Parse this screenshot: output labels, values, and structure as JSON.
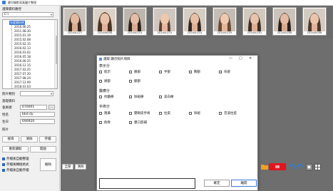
{
  "window": {
    "title": "慶印攝影寫真圖片整理"
  },
  "left": {
    "path_label": "選擇資料路徑",
    "drive": "C:\\",
    "tree_root": "年度資料夾",
    "tree_items": [
      "2010.06.25",
      "2011.08.30",
      "2015.01.19",
      "2015.02.08",
      "2015.02.15",
      "2016.02.13",
      "2016.03.02",
      "2016.05.18",
      "2016.06.25",
      "2016.12.15",
      "2017.02.25",
      "2017.07.20",
      "2017.08.24",
      "2017.12.09",
      "2018.03.03"
    ],
    "folder_label": "照片類別",
    "reg_label": "基礎資料",
    "reg_no_label": "會員號",
    "reg_no": "670001",
    "reg_btn": "...",
    "name_label": "姓名",
    "name_value": "bbd.dy",
    "birth_label": "生日",
    "birth_value": "690920",
    "photo_label": "照片",
    "btn_search": "搜尋",
    "btn_clear": "清除",
    "btn_save": "存檔",
    "btn_reload": "重新讀取",
    "btn_open": "開啟",
    "check1": "存檔後自動整理",
    "check2": "存檔後轉換格式",
    "check3": "存檔後自動存檔",
    "btn_delete": "刪除"
  },
  "thumbnails": [
    {
      "caption": "2024/01/27"
    },
    {
      "caption": "2024/06/08"
    },
    {
      "caption": "2024/02/14"
    },
    {
      "caption": "2024/01/15"
    },
    {
      "caption": "2024/01/14"
    },
    {
      "caption": "2024/01/29"
    },
    {
      "caption": "2024/01/01"
    },
    {
      "caption": "2024/03/08"
    },
    {
      "caption": "2024/05/06"
    }
  ],
  "toolbar": {
    "btn_all": "全部",
    "btn_clear": "清除"
  },
  "dialog": {
    "title": "選取 顯示照片項目",
    "ctl_min": "—",
    "ctl_max": "□",
    "ctl_close": "✕",
    "section1": "表示分",
    "section1_items": [
      "肌示",
      "臉部",
      "手部",
      "胸部",
      "背部",
      "頭部",
      "腳部"
    ],
    "section2": "醫療分",
    "section2_items": [
      "抗皺療",
      "除斑療",
      "美白療"
    ],
    "section3": "手術分",
    "section3_items": [
      "隆鼻",
      "雙眼皮手術",
      "拉皮",
      "除斑",
      "音波拉提",
      "削骨",
      "豐口唇補"
    ],
    "ok": "確定",
    "cancel": "離開"
  },
  "colors": {
    "tree_selection": "#3c78d8",
    "toolbar_red": "#e0161f",
    "toolbar_orange": "#f0a020",
    "checkbox_fill": "#2f6fd0"
  }
}
